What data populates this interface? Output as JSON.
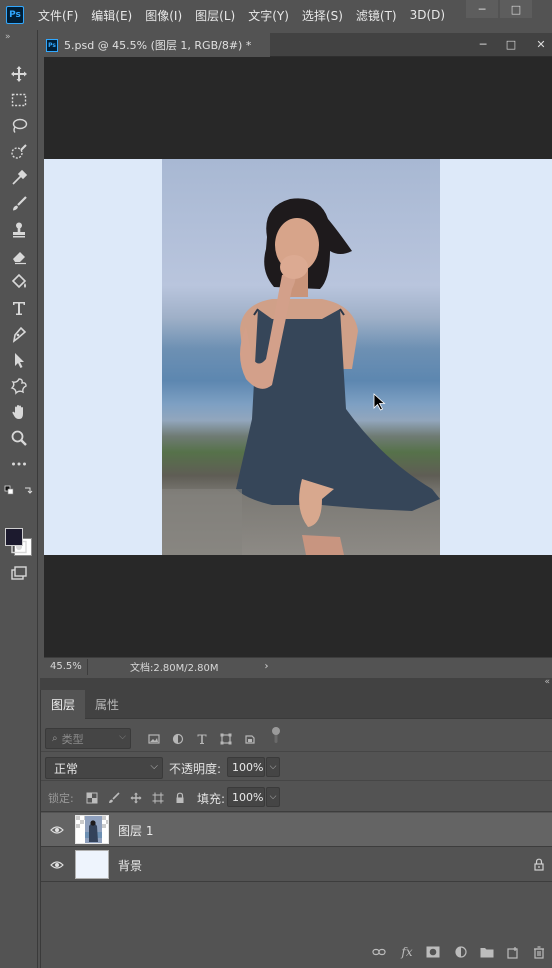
{
  "menubar": {
    "logo": "Ps",
    "items": [
      "文件(F)",
      "编辑(E)",
      "图像(I)",
      "图层(L)",
      "文字(Y)",
      "选择(S)",
      "滤镜(T)",
      "3D(D)"
    ],
    "minimize": "─",
    "maximize": "□"
  },
  "toolbar": {
    "collapse": "»",
    "tools": [
      "move-icon",
      "marquee-icon",
      "lasso-icon",
      "quick-select-icon",
      "eyedropper-icon",
      "brush-icon",
      "stamp-icon",
      "eraser-icon",
      "paint-bucket-icon",
      "type-icon",
      "pen-icon",
      "path-select-icon",
      "custom-shape-icon",
      "hand-icon",
      "zoom-icon",
      "more-tools-icon"
    ],
    "foreground_color": "#1c1a2e",
    "background_color": "#ffffff"
  },
  "document": {
    "tab_icon": "Ps",
    "tab_title": "5.psd @ 45.5% (图层 1, RGB/8#) *",
    "minimize": "─",
    "maximize": "□",
    "close": "✕",
    "canvas_bg": "#dde9f9"
  },
  "status": {
    "zoom": "45.5%",
    "doc_size": "文档:2.80M/2.80M",
    "arrow": "›"
  },
  "layers_panel": {
    "collapse": "«",
    "tabs": [
      "图层",
      "属性"
    ],
    "filter_placeholder": "类型",
    "blend_mode": "正常",
    "opacity_label": "不透明度:",
    "opacity_value": "100%",
    "lock_label": "锁定:",
    "fill_label": "填充:",
    "fill_value": "100%",
    "layers": [
      {
        "name": "图层 1",
        "selected": true,
        "locked": false
      },
      {
        "name": "背景",
        "selected": false,
        "locked": true
      }
    ]
  }
}
